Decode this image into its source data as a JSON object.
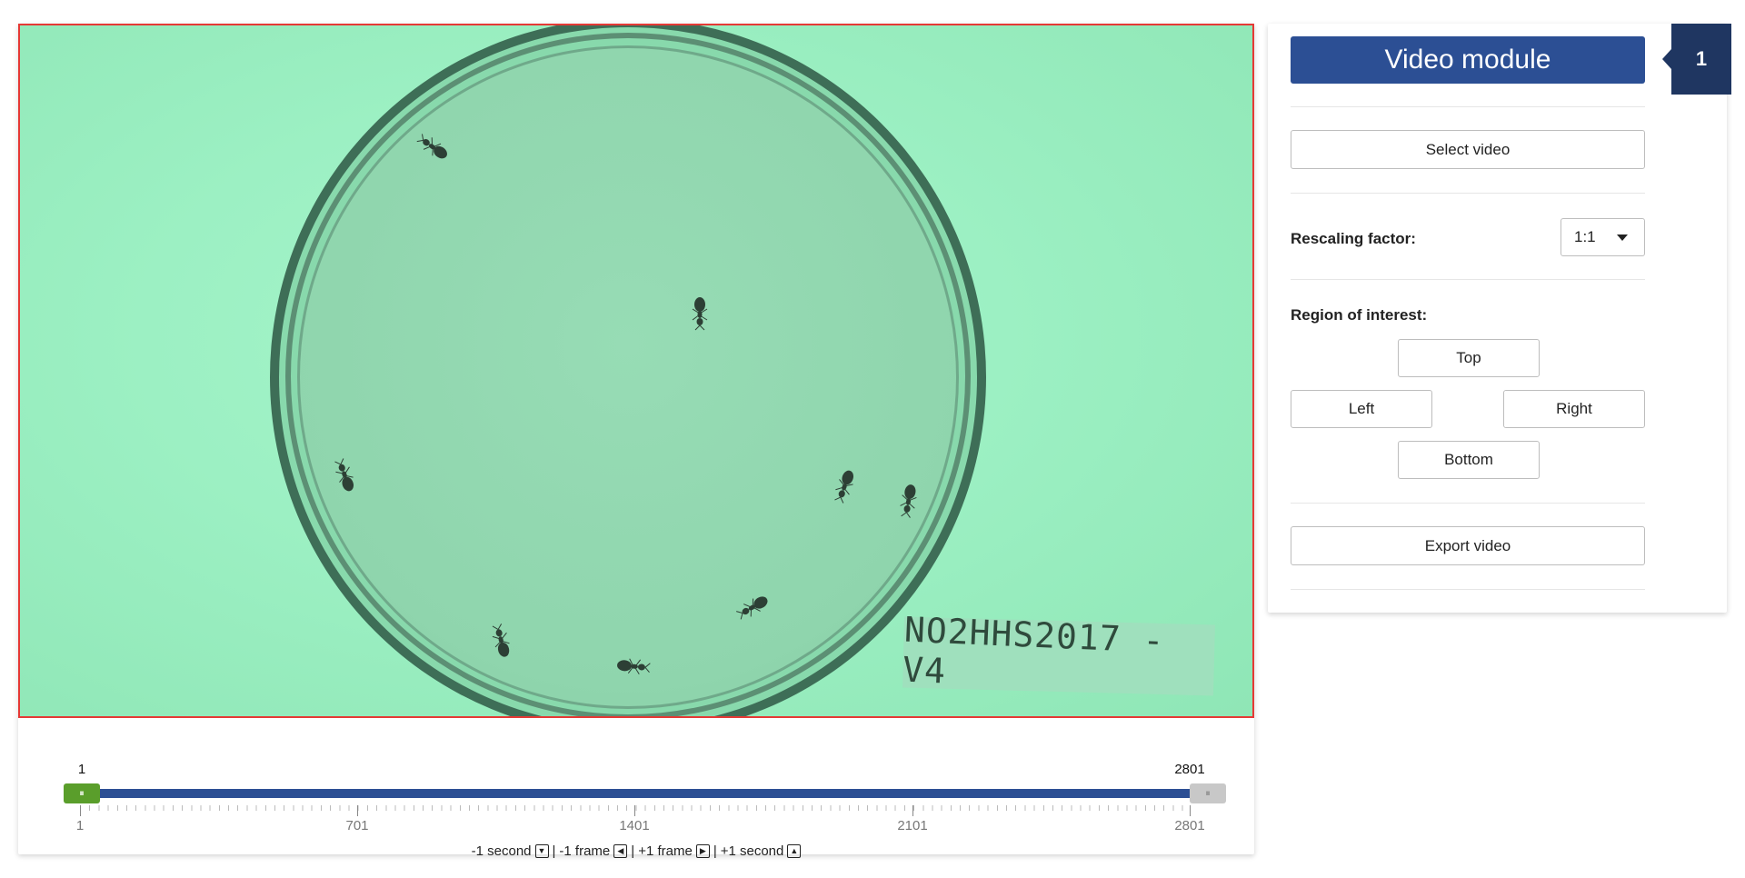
{
  "video": {
    "dish_label": "NO2HHS2017 - V4"
  },
  "slider": {
    "range_start": "1",
    "range_end": "2801",
    "handle_glyph": "⏸",
    "ticks": [
      "1",
      "701",
      "1401",
      "2101",
      "2801"
    ],
    "nav": {
      "minus_second": "-1 second",
      "minus_frame": "-1 frame",
      "plus_frame": "+1 frame",
      "plus_second": "+1 second",
      "separator": "|"
    }
  },
  "module": {
    "title": "Video module",
    "badge": "1",
    "select_video": "Select video",
    "rescaling_label": "Rescaling factor:",
    "rescaling_value": "1:1",
    "roi_label": "Region of interest:",
    "roi_top": "Top",
    "roi_left": "Left",
    "roi_right": "Right",
    "roi_bottom": "Bottom",
    "export_video": "Export video"
  },
  "colors": {
    "primary": "#2c4f94",
    "badge": "#1f3661",
    "handle_start": "#5a9e2b",
    "frame_border": "#e53935"
  }
}
